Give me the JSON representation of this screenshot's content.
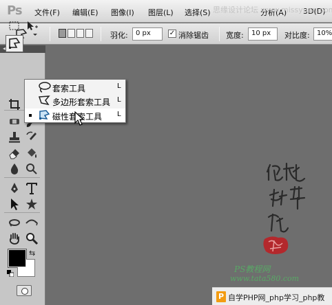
{
  "app": {
    "logo": "Ps"
  },
  "menubar": {
    "items": [
      "文件(F)",
      "编辑(E)",
      "图像(I)",
      "图层(L)",
      "选择(S)",
      "分析(A)",
      "3D(D)"
    ]
  },
  "watermark_top": "思缘设计论坛 www.missyuan.com",
  "options": {
    "feather_label": "羽化:",
    "feather_value": "0 px",
    "antialias_label": "消除锯齿",
    "antialias_checked": "✓",
    "width_label": "宽度:",
    "width_value": "10 px",
    "contrast_label": "对比度:",
    "contrast_value": "10%"
  },
  "toolbar": {
    "collapse": "◂◂"
  },
  "flyout": {
    "items": [
      {
        "label": "套索工具",
        "shortcut": "L",
        "icon": "lasso-icon"
      },
      {
        "label": "多边形套索工具",
        "shortcut": "L",
        "icon": "polygonal-lasso-icon"
      },
      {
        "label": "磁性套索工具",
        "shortcut": "L",
        "icon": "magnetic-lasso-icon",
        "selected": true
      }
    ]
  },
  "watermark": {
    "ps_tutorial": "PS教程网",
    "url": "www.tata580.com",
    "php_logo": "P",
    "php_text": "自学PHP网_php学习_php教"
  },
  "colors": {
    "foreground": "#000000",
    "background": "#ffffff",
    "canvas": "#6e6e6e"
  }
}
